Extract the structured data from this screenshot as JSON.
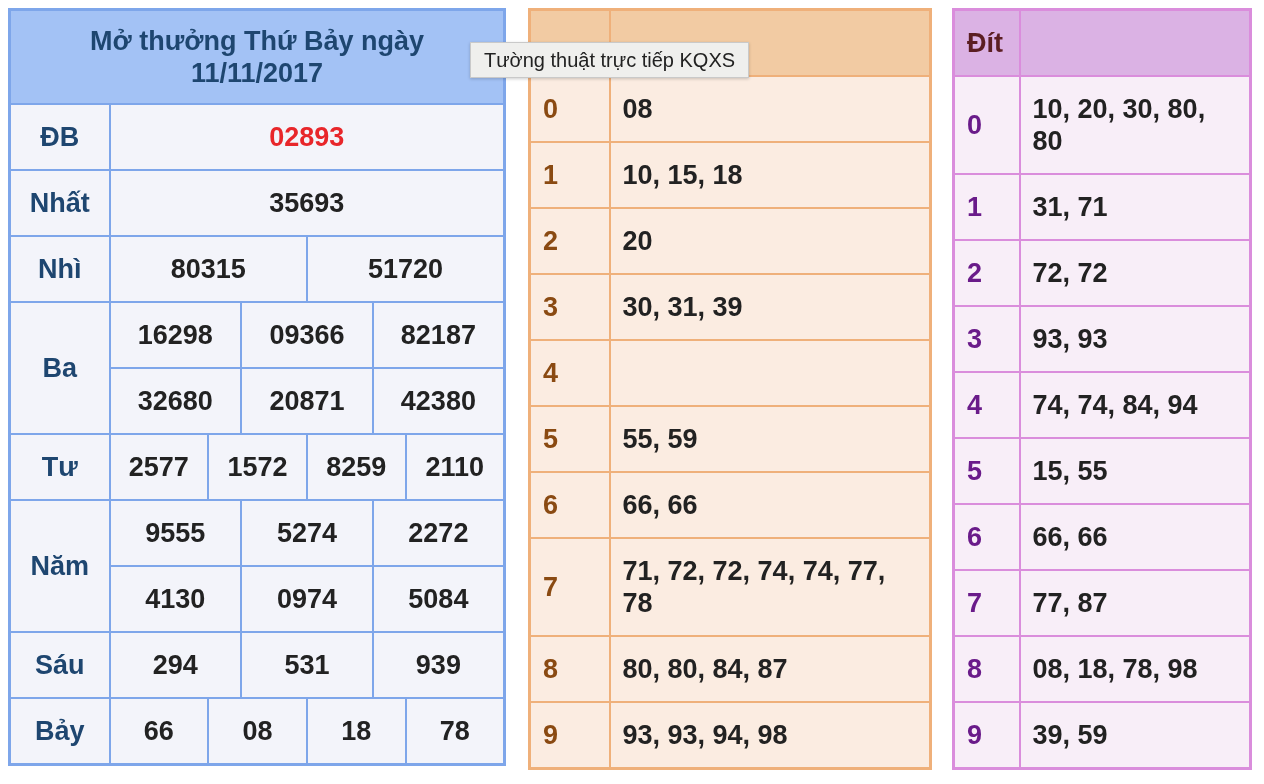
{
  "results": {
    "title": "Mở thưởng Thứ Bảy ngày 11/11/2017",
    "prizes": [
      {
        "name": "ĐB",
        "highlight": true,
        "rows": [
          [
            "02893"
          ]
        ]
      },
      {
        "name": "Nhất",
        "highlight": false,
        "rows": [
          [
            "35693"
          ]
        ]
      },
      {
        "name": "Nhì",
        "highlight": false,
        "rows": [
          [
            "80315",
            "51720"
          ]
        ]
      },
      {
        "name": "Ba",
        "highlight": false,
        "rows": [
          [
            "16298",
            "09366",
            "82187"
          ],
          [
            "32680",
            "20871",
            "42380"
          ]
        ]
      },
      {
        "name": "Tư",
        "highlight": false,
        "rows": [
          [
            "2577",
            "1572",
            "8259",
            "2110"
          ]
        ]
      },
      {
        "name": "Năm",
        "highlight": false,
        "rows": [
          [
            "9555",
            "5274",
            "2272"
          ],
          [
            "4130",
            "0974",
            "5084"
          ]
        ]
      },
      {
        "name": "Sáu",
        "highlight": false,
        "rows": [
          [
            "294",
            "531",
            "939"
          ]
        ]
      },
      {
        "name": "Bảy",
        "highlight": false,
        "rows": [
          [
            "66",
            "08",
            "18",
            "78"
          ]
        ]
      }
    ]
  },
  "head_table": {
    "rows": [
      {
        "digit": "0",
        "numbers": "08"
      },
      {
        "digit": "1",
        "numbers": "10, 15, 18"
      },
      {
        "digit": "2",
        "numbers": "20"
      },
      {
        "digit": "3",
        "numbers": "30, 31, 39"
      },
      {
        "digit": "4"
      },
      {
        "digit": "5",
        "numbers": "55, 59"
      },
      {
        "digit": "6",
        "numbers": "66, 66"
      },
      {
        "digit": "7",
        "numbers": "71, 72, 72, 74, 74, 77, 78"
      },
      {
        "digit": "8",
        "numbers": "80, 80, 84, 87"
      },
      {
        "digit": "9",
        "numbers": "93, 93, 94, 98"
      }
    ]
  },
  "tail_table": {
    "heading": "Đít",
    "rows": [
      {
        "digit": "0",
        "numbers": "10, 20, 30, 80, 80"
      },
      {
        "digit": "1",
        "numbers": "31, 71"
      },
      {
        "digit": "2",
        "numbers": "72, 72"
      },
      {
        "digit": "3",
        "numbers": "93, 93"
      },
      {
        "digit": "4",
        "numbers": "74, 74, 84, 94"
      },
      {
        "digit": "5",
        "numbers": "15, 55"
      },
      {
        "digit": "6",
        "numbers": "66, 66"
      },
      {
        "digit": "7",
        "numbers": "77, 87"
      },
      {
        "digit": "8",
        "numbers": "08, 18, 78, 98"
      },
      {
        "digit": "9",
        "numbers": "39, 59"
      }
    ]
  },
  "tooltip": {
    "text": "Tường thuật trực tiếp KQXS"
  }
}
